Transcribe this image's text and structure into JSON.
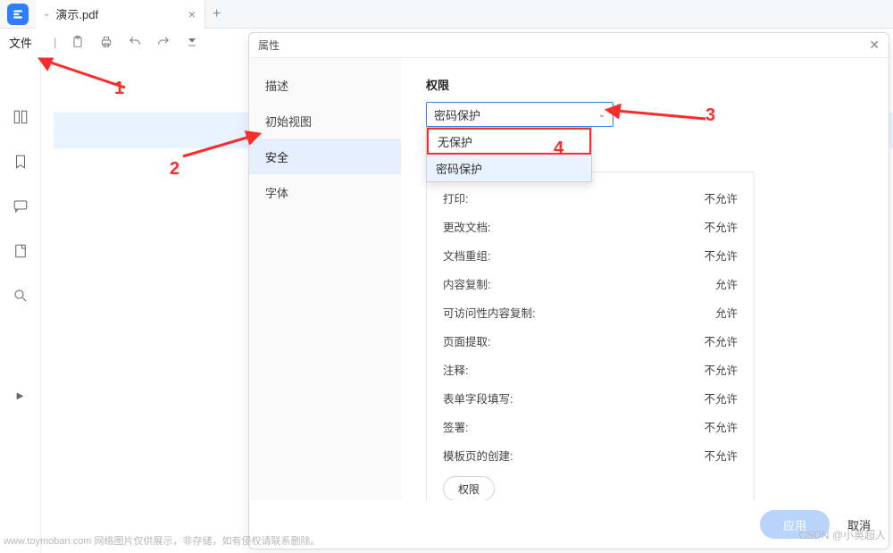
{
  "tab": {
    "title": "演示.pdf"
  },
  "toolbar": {
    "file_label": "文件"
  },
  "dialog": {
    "title": "属性",
    "side": {
      "items": [
        "描述",
        "初始视图",
        "安全",
        "字体"
      ],
      "active": 2
    },
    "section_label": "权限",
    "select_value": "密码保护",
    "dropdown": {
      "options": [
        "无保护",
        "密码保护"
      ]
    },
    "perms": [
      {
        "k": "打印:",
        "v": "不允许"
      },
      {
        "k": "更改文档:",
        "v": "不允许"
      },
      {
        "k": "文档重组:",
        "v": "不允许"
      },
      {
        "k": "内容复制:",
        "v": "允许"
      },
      {
        "k": "可访问性内容复制:",
        "v": "允许"
      },
      {
        "k": "页面提取:",
        "v": "不允许"
      },
      {
        "k": "注释:",
        "v": "不允许"
      },
      {
        "k": "表单字段填写:",
        "v": "不允许"
      },
      {
        "k": "签署:",
        "v": "不允许"
      },
      {
        "k": "模板页的创建:",
        "v": "不允许"
      }
    ],
    "perm_btn": "权限",
    "apply": "应用",
    "cancel": "取消"
  },
  "annotations": {
    "n1": "1",
    "n2": "2",
    "n3": "3",
    "n4": "4"
  },
  "watermarks": {
    "w1": "www.toymoban.com  网络图片仅供展示，非存储，如有侵权请联系删除。",
    "w2": "CSDN @小奥超人"
  }
}
